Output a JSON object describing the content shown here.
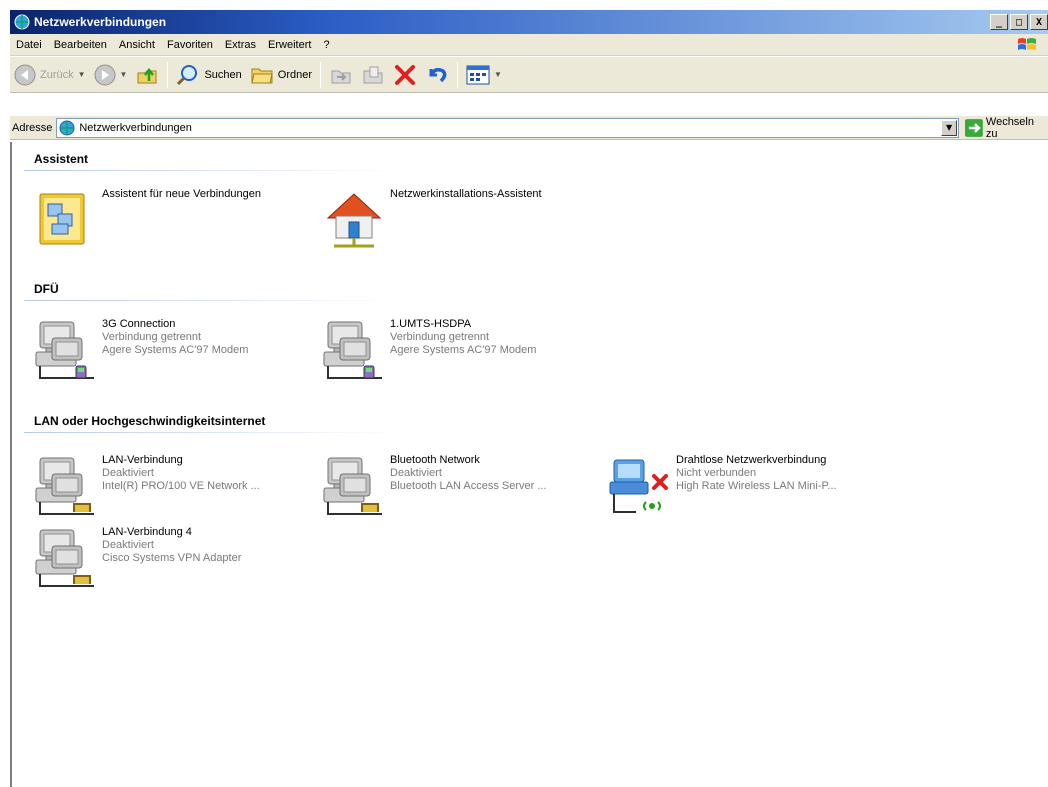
{
  "window": {
    "title": "Netzwerkverbindungen",
    "controls": {
      "minimize": "_",
      "maximize": "□",
      "close": "X"
    }
  },
  "menubar": {
    "items": [
      {
        "label": "Datei"
      },
      {
        "label": "Bearbeiten"
      },
      {
        "label": "Ansicht"
      },
      {
        "label": "Favoriten"
      },
      {
        "label": "Extras"
      },
      {
        "label": "Erweitert"
      },
      {
        "label": "?"
      }
    ]
  },
  "toolbar": {
    "back_label": "Zurück",
    "search_label": "Suchen",
    "folders_label": "Ordner"
  },
  "address": {
    "label": "Adresse",
    "value": "Netzwerkverbindungen",
    "go_label": "Wechseln zu"
  },
  "groups": [
    {
      "name": "Assistent",
      "items": [
        {
          "title": "Assistent für neue Verbindungen",
          "icon": "new-connection-wizard-icon"
        },
        {
          "title": "Netzwerkinstallations-Assistent",
          "icon": "network-setup-wizard-icon"
        }
      ]
    },
    {
      "name": "DFÜ",
      "items": [
        {
          "title": "3G Connection",
          "status": "Verbindung getrennt",
          "device": "Agere Systems AC'97 Modem",
          "icon": "dialup-connection-icon"
        },
        {
          "title": "1.UMTS-HSDPA",
          "status": "Verbindung getrennt",
          "device": "Agere Systems AC'97 Modem",
          "icon": "dialup-connection-icon"
        }
      ]
    },
    {
      "name": "LAN oder Hochgeschwindigkeitsinternet",
      "items": [
        {
          "title": "LAN-Verbindung",
          "status": "Deaktiviert",
          "device": "Intel(R) PRO/100 VE Network ...",
          "icon": "lan-connection-icon"
        },
        {
          "title": "Bluetooth Network",
          "status": "Deaktiviert",
          "device": "Bluetooth LAN Access Server ...",
          "icon": "lan-connection-icon"
        },
        {
          "title": "Drahtlose Netzwerkverbindung",
          "status": "Nicht verbunden",
          "device": "High Rate Wireless LAN Mini-P...",
          "icon": "wireless-connection-icon"
        },
        {
          "title": "LAN-Verbindung 4",
          "status": "Deaktiviert",
          "device": "Cisco Systems VPN Adapter",
          "icon": "lan-connection-icon"
        }
      ]
    }
  ]
}
